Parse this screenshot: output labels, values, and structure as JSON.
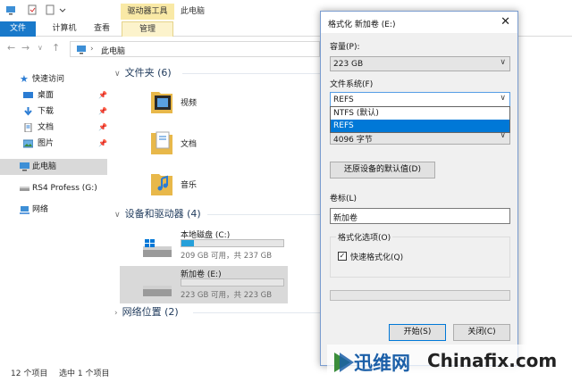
{
  "explorer": {
    "title": "此电脑",
    "context_tab": "驱动器工具",
    "tabs": [
      "文件",
      "计算机",
      "查看",
      "管理"
    ],
    "address": "此电脑",
    "nav": [
      {
        "label": "快速访问",
        "icon": "star-icon",
        "pinned": false,
        "sub": false
      },
      {
        "label": "桌面",
        "icon": "desktop-icon",
        "pinned": true,
        "sub": true
      },
      {
        "label": "下载",
        "icon": "download-icon",
        "pinned": true,
        "sub": true
      },
      {
        "label": "文档",
        "icon": "document-icon",
        "pinned": true,
        "sub": true
      },
      {
        "label": "图片",
        "icon": "picture-icon",
        "pinned": true,
        "sub": true
      },
      {
        "label": "此电脑",
        "icon": "computer-icon",
        "pinned": false,
        "sub": false
      },
      {
        "label": "RS4 Profess (G:)",
        "icon": "drive-icon",
        "pinned": false,
        "sub": false
      },
      {
        "label": "网络",
        "icon": "network-icon",
        "pinned": false,
        "sub": false
      }
    ],
    "pin_glyph": "📌",
    "groups": {
      "folders": "文件夹 (6)",
      "drives": "设备和驱动器 (4)",
      "network": "网络位置 (2)"
    },
    "folders": [
      "视频",
      "文档",
      "音乐"
    ],
    "drive_list": [
      {
        "name": "本地磁盘 (C:)",
        "free": "209 GB 可用，共 237 GB",
        "used_fraction": 0.12
      },
      {
        "name": "新加卷 (E:)",
        "free": "223 GB 可用，共 223 GB",
        "used_fraction": 0.0
      }
    ],
    "status": {
      "count": "12 个项目",
      "selected": "选中 1 个项目"
    }
  },
  "dialog": {
    "title": "格式化 新加卷 (E:)",
    "capacity_label": "容量(P):",
    "capacity_value": "223 GB",
    "fs_label": "文件系统(F)",
    "fs_value": "REFS",
    "fs_options": [
      "NTFS (默认)",
      "REFS"
    ],
    "alloc_value": "4096 字节",
    "restore_button": "还原设备的默认值(D)",
    "volume_label": "卷标(L)",
    "volume_value": "新加卷",
    "options_legend": "格式化选项(O)",
    "quick_format": "快速格式化(Q)",
    "start_button": "开始(S)",
    "close_button": "关闭(C)"
  },
  "watermark": {
    "cn": "迅维网",
    "en": "Chinafix.com"
  },
  "colors": {
    "accent": "#1979ca",
    "selection": "#0078d7",
    "drive_fill": "#26a0da"
  }
}
